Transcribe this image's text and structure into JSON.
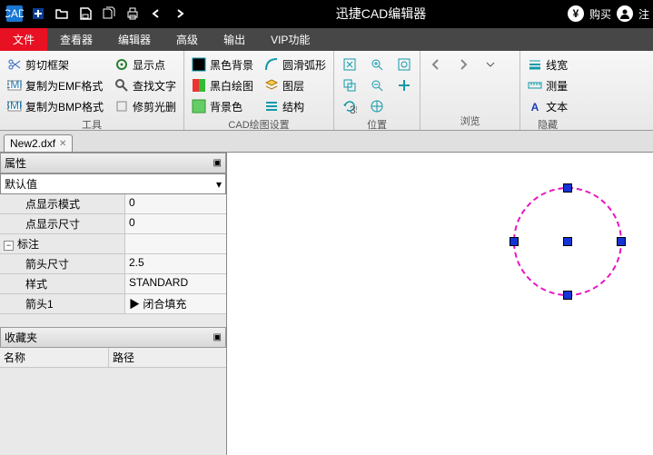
{
  "title": "迅捷CAD编辑器",
  "titlebar_right": {
    "buy": "购买",
    "login": "注"
  },
  "menu": [
    "文件",
    "查看器",
    "编辑器",
    "高级",
    "输出",
    "VIP功能"
  ],
  "menu_active_index": 0,
  "ribbon": {
    "group1": {
      "label": "工具",
      "col1": [
        "剪切框架",
        "复制为EMF格式",
        "复制为BMP格式"
      ],
      "col2": [
        "显示点",
        "查找文字",
        "修剪光删"
      ]
    },
    "group2": {
      "label": "CAD绘图设置",
      "col1": [
        "黑色背景",
        "黑白绘图",
        "背景色"
      ],
      "col2": [
        "圆滑弧形",
        "图层",
        "结构"
      ]
    },
    "group3": {
      "label": "位置"
    },
    "group4": {
      "label": "浏览"
    },
    "group5": {
      "label": "隐藏",
      "items": [
        "线宽",
        "测量",
        "文本"
      ]
    }
  },
  "document_tab": "New2.dxf",
  "panels": {
    "properties": {
      "title": "属性",
      "default": "默认值",
      "rows": [
        {
          "label": "点显示模式",
          "value": "0"
        },
        {
          "label": "点显示尺寸",
          "value": "0"
        }
      ],
      "group": "标注",
      "groupRows": [
        {
          "label": "箭头尺寸",
          "value": "2.5"
        },
        {
          "label": "样式",
          "value": "STANDARD"
        },
        {
          "label": "箭头1",
          "value": "闭合填充",
          "hasIcon": true
        }
      ]
    },
    "favorites": {
      "title": "收藏夹",
      "cols": [
        "名称",
        "路径"
      ]
    }
  }
}
